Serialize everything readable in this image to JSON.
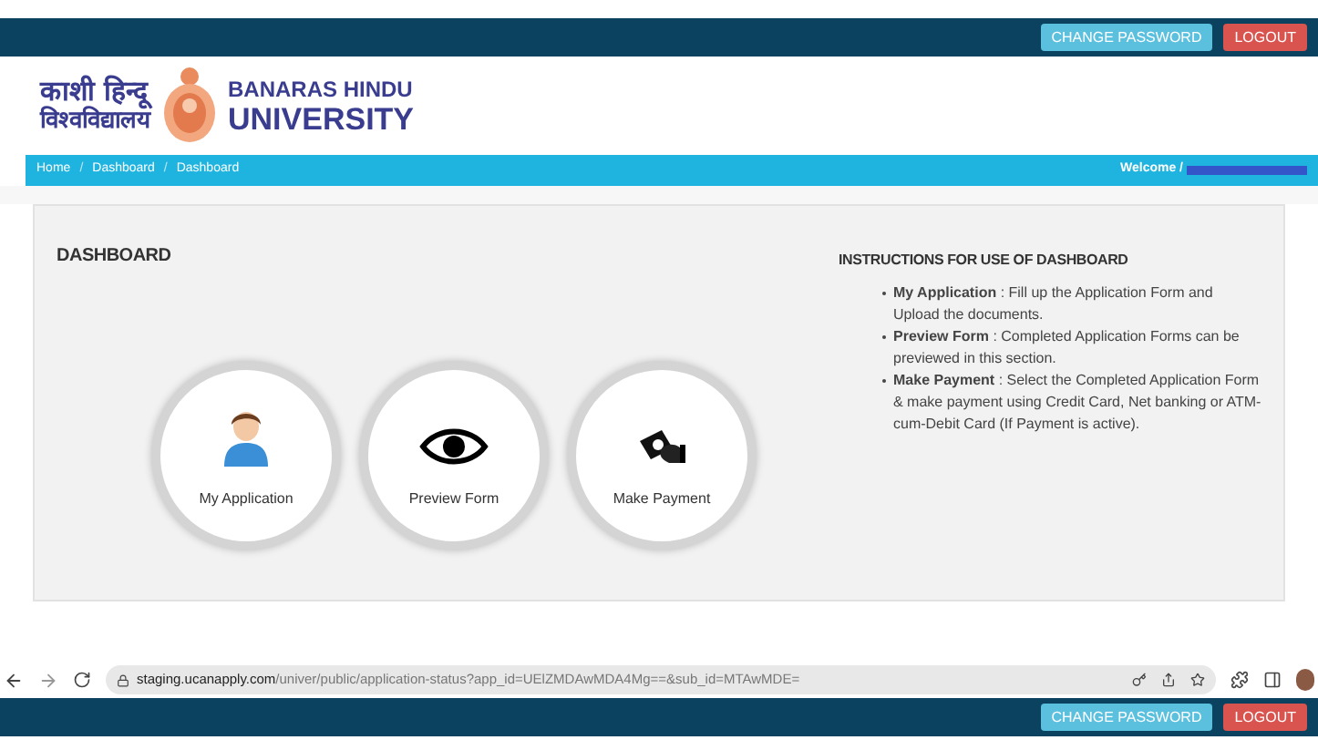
{
  "top_bar": {
    "buttons": [
      {
        "label": "CHANGE PASSWORD",
        "kind": "info"
      },
      {
        "label": "LOGOUT",
        "kind": "danger"
      }
    ]
  },
  "logo": {
    "hindi_line_1": "काशी हिन्दू",
    "hindi_line_2": "विश्वविद्यालय",
    "english_line_1": "BANARAS HINDU",
    "english_line_2": "UNIVERSITY"
  },
  "breadcrumb": {
    "items": [
      "Home",
      "Dashboard",
      "Dashboard"
    ],
    "separator": "/",
    "welcome": "Welcome /"
  },
  "dashboard": {
    "title": "DASHBOARD",
    "tiles": [
      {
        "label": "My Application",
        "kind": "user"
      },
      {
        "label": "Preview Form",
        "kind": "eye"
      },
      {
        "label": "Make Payment",
        "kind": "payment"
      }
    ]
  },
  "instructions": {
    "title": "INSTRUCTIONS FOR USE OF DASHBOARD",
    "items": [
      "**My Application** : Fill up the Application Form and Upload the documents.",
      "**Preview Form** : Completed Application Forms can be previewed in this section.",
      "**Make Payment** : Select the Completed Application Form & make payment using Credit Card, Net banking or ATM-cum-Debit Card (If Payment is active)."
    ]
  },
  "browser": {
    "url_host": "staging.ucanapply.com",
    "url_path": "/univer/public/application-status?app_id=UElZMDAwMDA4Mg==&sub_id=MTAwMDE="
  },
  "bottom_bar": {
    "buttons": [
      {
        "label": "CHANGE PASSWORD",
        "kind": "info"
      },
      {
        "label": "LOGOUT",
        "kind": "danger"
      }
    ]
  }
}
